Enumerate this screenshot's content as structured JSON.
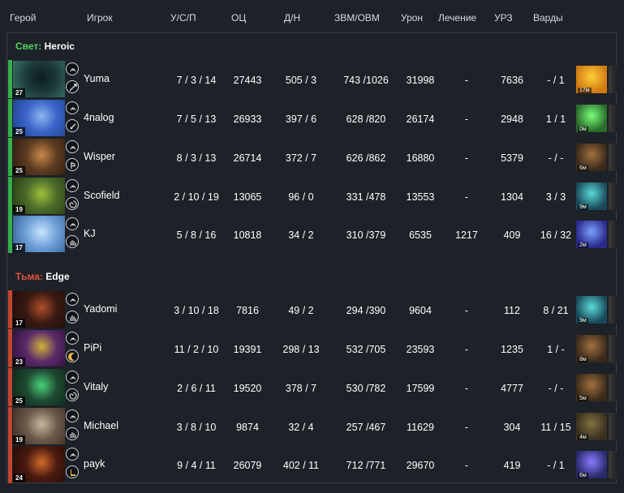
{
  "header": {
    "hero": "Герой",
    "player": "Игрок",
    "kda": "У/С/П",
    "score": "ОЦ",
    "lh_dn": "Д/Н",
    "gpm_xpm": "ЗВМ/ОВМ",
    "damage": "Урон",
    "healing": "Лечение",
    "tower_damage": "УРЗ",
    "wards": "Варды"
  },
  "teams": [
    {
      "side": "Свет:",
      "name": "Heroic",
      "color": "#36b14a",
      "players": [
        {
          "player": "Yuma",
          "level": "27",
          "kda": "7 / 3 / 14",
          "score": "27443",
          "lh_dn": "505 / 3",
          "gpm_xpm": "743 /1026",
          "damage": "31998",
          "healing": "-",
          "tower_damage": "7636",
          "wards": "- / 1",
          "item_time": "17м",
          "icons": [
            "hero-portrait-icon",
            "sword-icon"
          ]
        },
        {
          "player": "4nalog",
          "level": "25",
          "kda": "7 / 5 / 13",
          "score": "26933",
          "lh_dn": "397 / 6",
          "gpm_xpm": "628 /820",
          "damage": "26174",
          "healing": "-",
          "tower_damage": "2948",
          "wards": "1 / 1",
          "item_time": "0м",
          "icons": [
            "hero-portrait-icon",
            "dagger-icon"
          ]
        },
        {
          "player": "Wisper",
          "level": "25",
          "kda": "8 / 3 / 13",
          "score": "26714",
          "lh_dn": "372 / 7",
          "gpm_xpm": "626 /862",
          "damage": "16880",
          "healing": "-",
          "tower_damage": "5379",
          "wards": "- / -",
          "item_time": "6м",
          "icons": [
            "hero-portrait-icon",
            "axe-icon"
          ]
        },
        {
          "player": "Scofield",
          "level": "19",
          "kda": "2 / 10 / 19",
          "score": "13065",
          "lh_dn": "96 / 0",
          "gpm_xpm": "331 /478",
          "damage": "13553",
          "healing": "-",
          "tower_damage": "1304",
          "wards": "3 / 3",
          "item_time": "9м",
          "icons": [
            "hero-portrait-icon",
            "swirl-icon"
          ]
        },
        {
          "player": "KJ",
          "level": "17",
          "kda": "5 / 8 / 16",
          "score": "10818",
          "lh_dn": "34 / 2",
          "gpm_xpm": "310 /379",
          "damage": "6535",
          "healing": "1217",
          "tower_damage": "409",
          "wards": "16 / 32",
          "item_time": "2м",
          "icons": [
            "hero-portrait-icon",
            "hand-icon"
          ]
        }
      ]
    },
    {
      "side": "Тьма:",
      "name": "Edge",
      "color": "#c4452f",
      "players": [
        {
          "player": "Yadomi",
          "level": "17",
          "kda": "3 / 10 / 18",
          "score": "7816",
          "lh_dn": "49 / 2",
          "gpm_xpm": "294 /390",
          "damage": "9604",
          "healing": "-",
          "tower_damage": "112",
          "wards": "8 / 21",
          "item_time": "9м",
          "icons": [
            "hero-portrait-icon",
            "hand-icon"
          ]
        },
        {
          "player": "PiPi",
          "level": "23",
          "kda": "11 / 2 / 10",
          "score": "19391",
          "lh_dn": "298 / 13",
          "gpm_xpm": "532 /705",
          "damage": "23593",
          "healing": "-",
          "tower_damage": "1235",
          "wards": "1 / -",
          "item_time": "8м",
          "icons": [
            "hero-portrait-icon",
            "moon-icon"
          ]
        },
        {
          "player": "Vitaly",
          "level": "25",
          "kda": "2 / 6 / 11",
          "score": "19520",
          "lh_dn": "378 / 7",
          "gpm_xpm": "530 /782",
          "damage": "17599",
          "healing": "-",
          "tower_damage": "4777",
          "wards": "- / -",
          "item_time": "5м",
          "icons": [
            "hero-portrait-icon",
            "swirl-icon"
          ]
        },
        {
          "player": "Michael",
          "level": "19",
          "kda": "3 / 8 / 10",
          "score": "9874",
          "lh_dn": "32 / 4",
          "gpm_xpm": "257 /467",
          "damage": "11629",
          "healing": "-",
          "tower_damage": "304",
          "wards": "11 / 15",
          "item_time": "4м",
          "icons": [
            "hero-portrait-icon",
            "hand-icon"
          ]
        },
        {
          "player": "payk",
          "level": "24",
          "kda": "9 / 4 / 11",
          "score": "26079",
          "lh_dn": "402 / 11",
          "gpm_xpm": "712 /771",
          "damage": "29670",
          "healing": "-",
          "tower_damage": "419",
          "wards": "- / 1",
          "item_time": "6м",
          "icons": [
            "hero-portrait-icon",
            "boot-icon"
          ]
        }
      ]
    }
  ],
  "colors": {
    "background": "#1d2128",
    "light_side": "#36b14a",
    "dark_side": "#c4452f",
    "text": "#ffffff"
  }
}
